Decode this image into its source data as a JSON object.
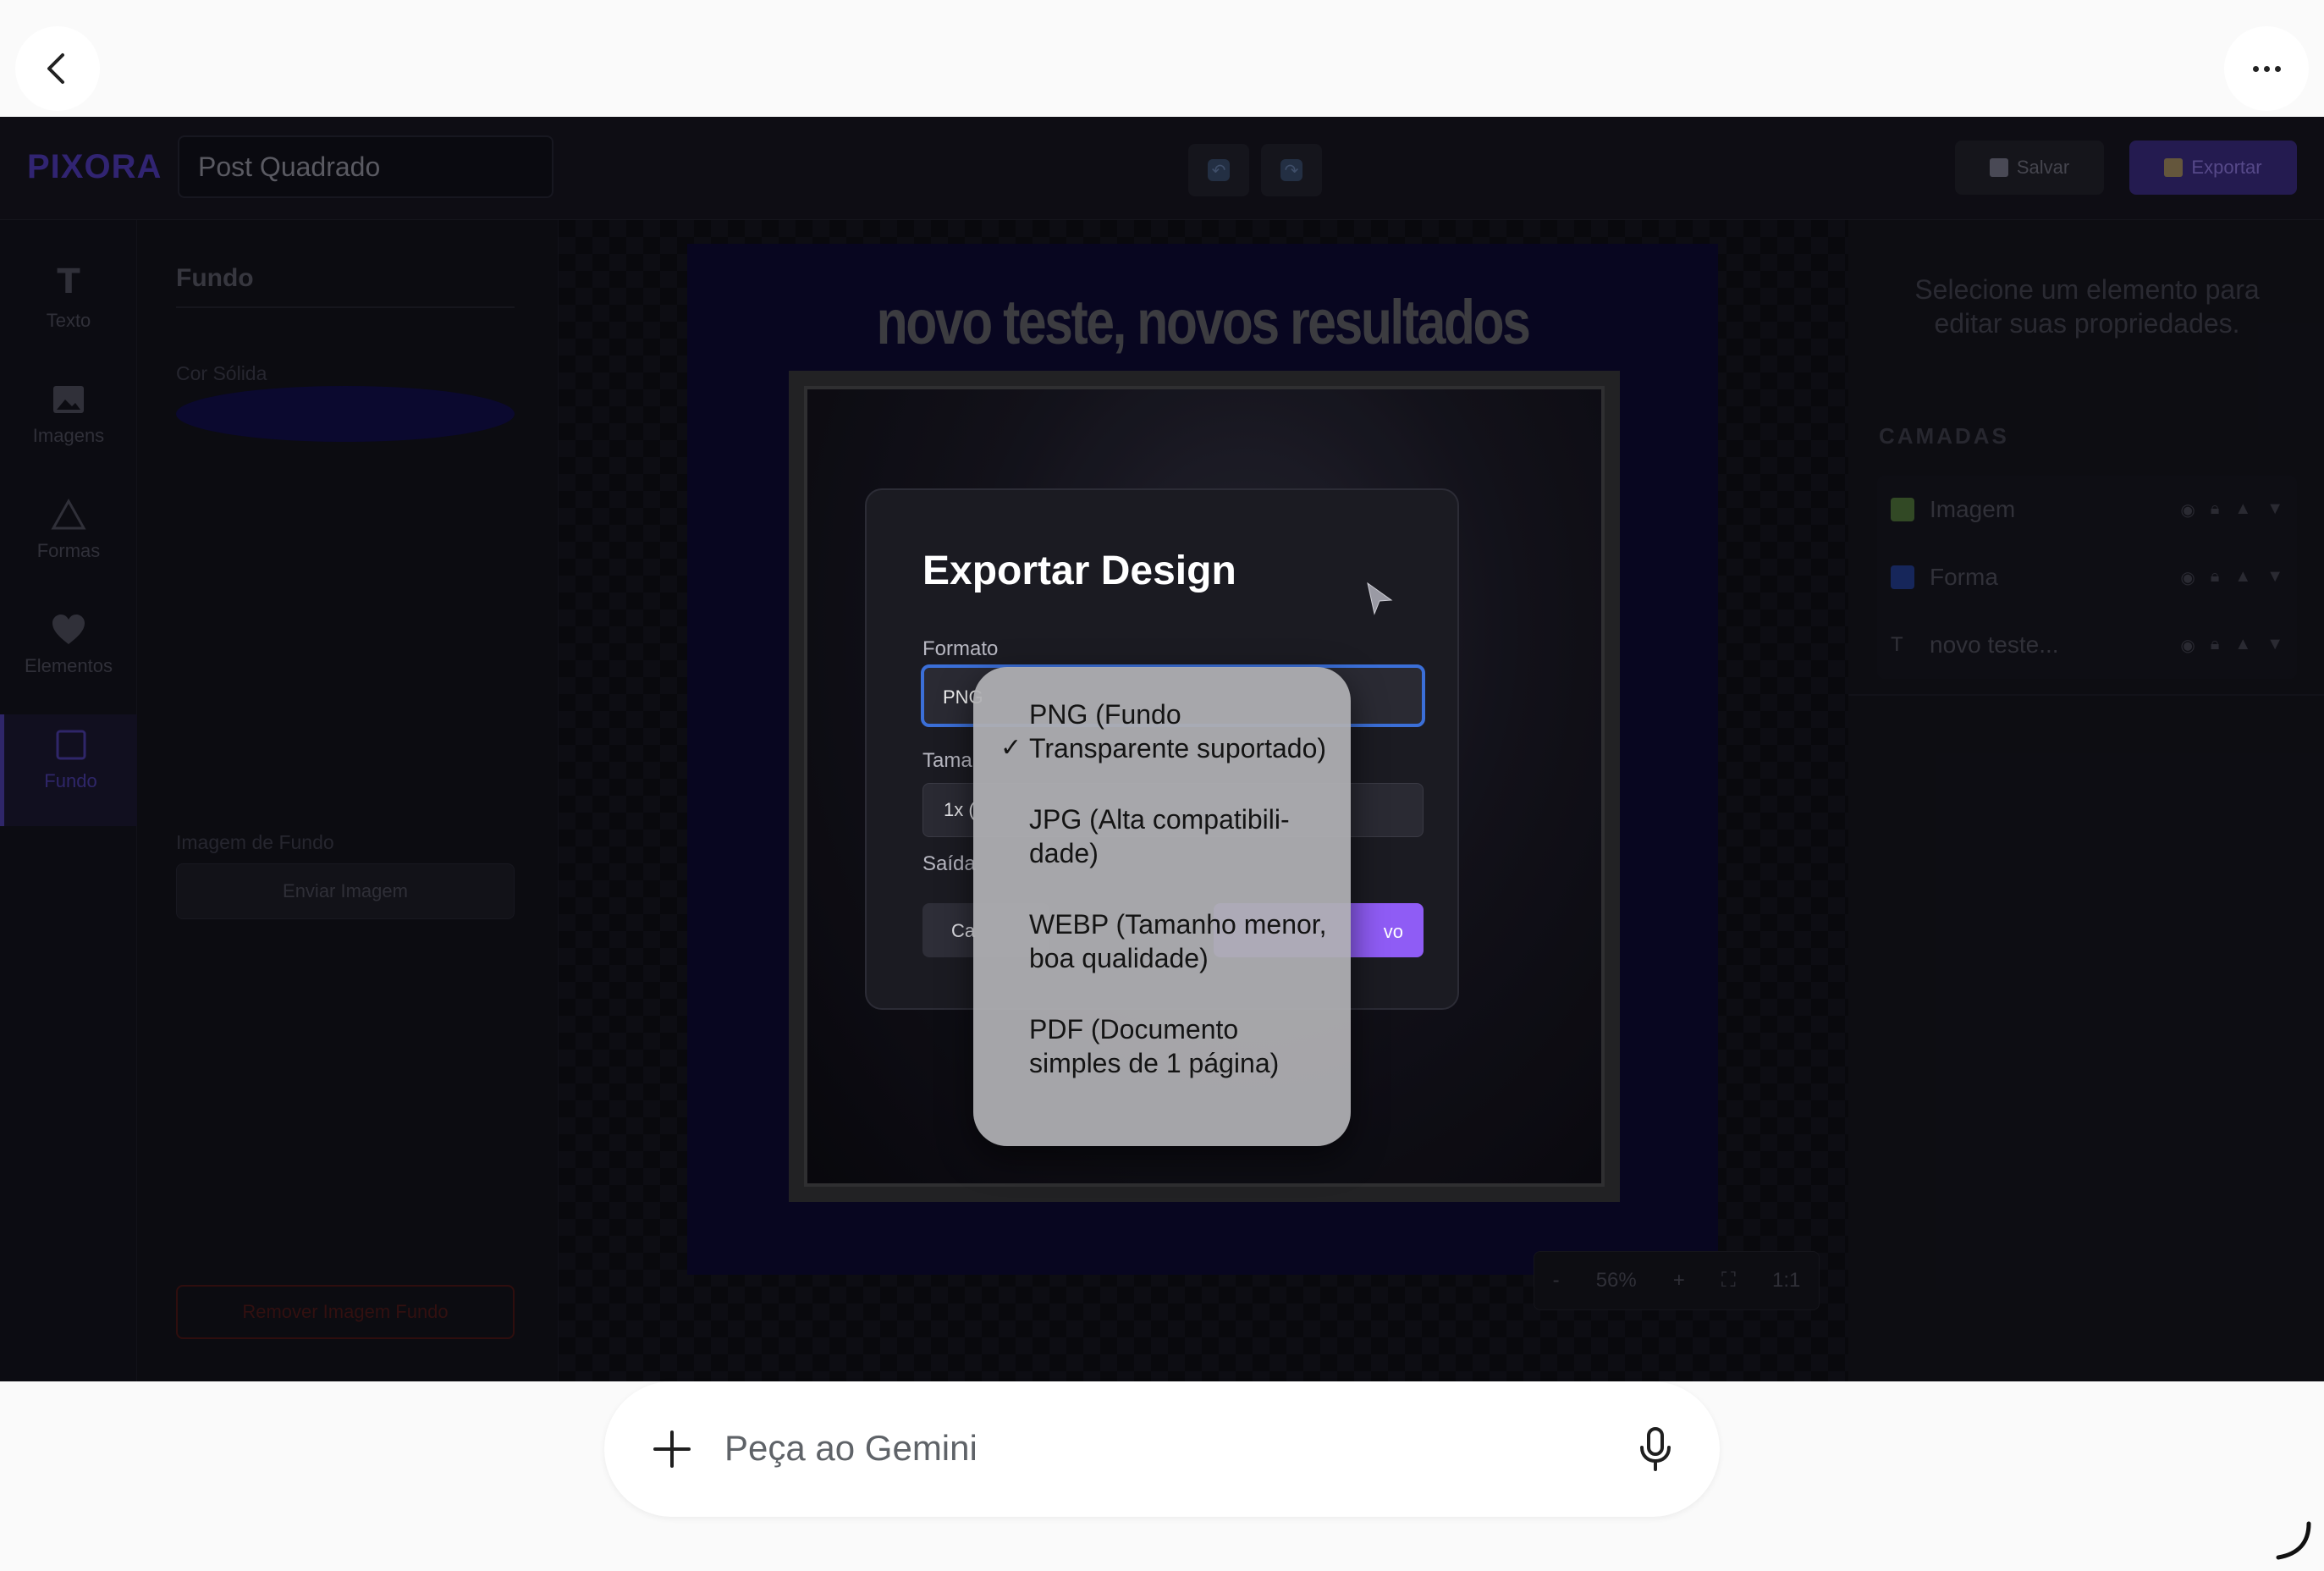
{
  "editor": {
    "logo": "PIXORA",
    "design_title": "Post Quadrado",
    "save_label": "Salvar",
    "export_label": "Exportar",
    "rail": [
      "Texto",
      "Imagens",
      "Formas",
      "Elementos",
      "Fundo"
    ],
    "active_rail": "Fundo",
    "props": {
      "title": "Fundo",
      "solid_color_label": "Cor Sólida",
      "solid_color": "#0e0b3a",
      "bg_image_label": "Imagem de Fundo",
      "upload_label": "Enviar Imagem",
      "remove_label": "Remover Imagem Fundo"
    },
    "canvas": {
      "headline": "novo teste, novos resultados",
      "zoom_minus": "-",
      "zoom_level": "56%",
      "zoom_plus": "+",
      "zoom_reset": "1:1"
    },
    "right_panel": {
      "hint": "Selecione um elemento para editar suas propriedades.",
      "layers_title": "CAMADAS",
      "layers": [
        {
          "name": "Imagem",
          "icon": "image-layer-icon"
        },
        {
          "name": "Forma",
          "icon": "shape-layer-icon"
        },
        {
          "name": "novo teste...",
          "icon": "text-layer-icon"
        }
      ]
    }
  },
  "modal": {
    "title": "Exportar Design",
    "format_label": "Formato",
    "format_value": "PNG",
    "size_label": "Tama",
    "size_value": "1x (",
    "output_label": "Saída",
    "cancel_label": "Ca",
    "download_label": "vo",
    "accent": "#8f5cf5"
  },
  "dropdown": {
    "selected_index": 0,
    "options": [
      "PNG (Fundo Transparente suportado)",
      "JPG (Alta compatibili-dade)",
      "WEBP (Tamanho menor, boa qualidade)",
      "PDF (Documento simples de 1 página)"
    ]
  },
  "assistant": {
    "placeholder": "Peça ao Gemini"
  }
}
